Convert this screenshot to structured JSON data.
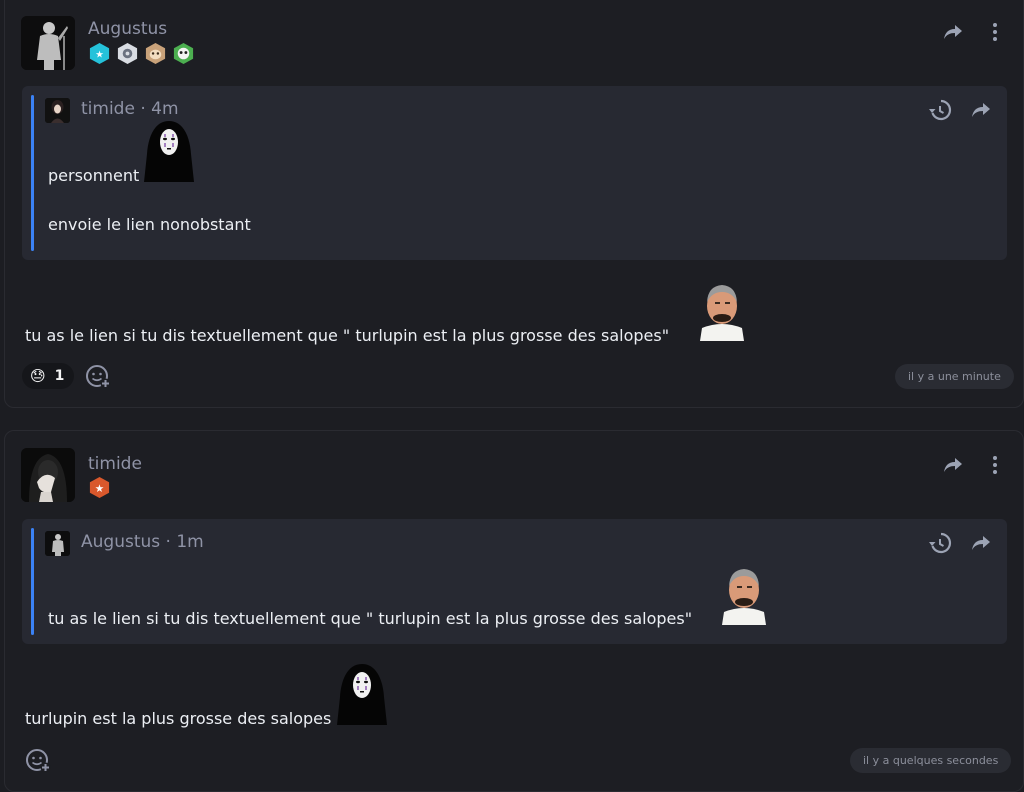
{
  "posts": [
    {
      "author": "Augustus",
      "badges": [
        "stars-badge",
        "gear-badge",
        "sloth-badge",
        "panda-badge"
      ],
      "quote": {
        "author": "timide",
        "time": " · 4m",
        "lines": [
          "personnent",
          "envoie le lien nonobstant"
        ]
      },
      "body": "tu as le lien si tu dis textuellement que \" turlupin est la plus grosse des salopes\"",
      "reactions": [
        {
          "emoji": "😓",
          "count": "1"
        }
      ],
      "timestamp": "il y a une minute"
    },
    {
      "author": "timide",
      "badges": [
        "star-badge"
      ],
      "quote": {
        "author": "Augustus",
        "time": " · 1m",
        "lines": [
          "tu as le lien si tu dis textuellement que \" turlupin est la plus grosse des salopes\""
        ]
      },
      "body": "turlupin est la plus grosse des salopes",
      "timestamp": "il y a quelques secondes"
    }
  ],
  "colors": {
    "background": "#1c1d22",
    "quote_background": "#272932",
    "quote_accent": "#3b82f6",
    "muted_text": "#8f93a6"
  }
}
